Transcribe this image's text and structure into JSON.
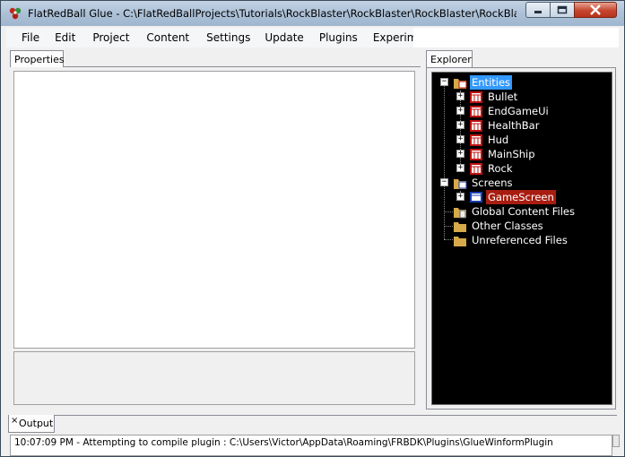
{
  "window": {
    "title": "FlatRedBall Glue - C:\\FlatRedBallProjects\\Tutorials\\RockBlaster\\RockBlaster\\RockBlaster\\RockBlaster.csproj",
    "app_icon": "glue-app-icon",
    "controls": {
      "minimize_icon": "minimize-icon",
      "maximize_icon": "maximize-icon",
      "close_icon": "close-icon"
    }
  },
  "menu": {
    "items": [
      "File",
      "Edit",
      "Project",
      "Content",
      "Settings",
      "Update",
      "Plugins",
      "Experimental"
    ]
  },
  "panels": {
    "properties_tab": "Properties",
    "explorer_tab": "Explorer",
    "output_tab": "Output",
    "output_close": "×"
  },
  "tree": {
    "entities_label": "Entities",
    "entities": [
      "Bullet",
      "EndGameUi",
      "HealthBar",
      "Hud",
      "MainShip",
      "Rock"
    ],
    "screens_label": "Screens",
    "screens": [
      "GameScreen"
    ],
    "global_content": "Global Content Files",
    "other_classes": "Other Classes",
    "unreferenced": "Unreferenced Files",
    "expand_minus": "−",
    "expand_plus": "+",
    "colors": {
      "selected_blue": "#3399ff",
      "selected_red": "#a81d10",
      "background": "#000000"
    }
  },
  "output": {
    "line": "10:07:09 PM - Attempting to compile plugin : C:\\Users\\Victor\\AppData\\Roaming\\FRBDK\\Plugins\\GlueWinformPlugin"
  }
}
